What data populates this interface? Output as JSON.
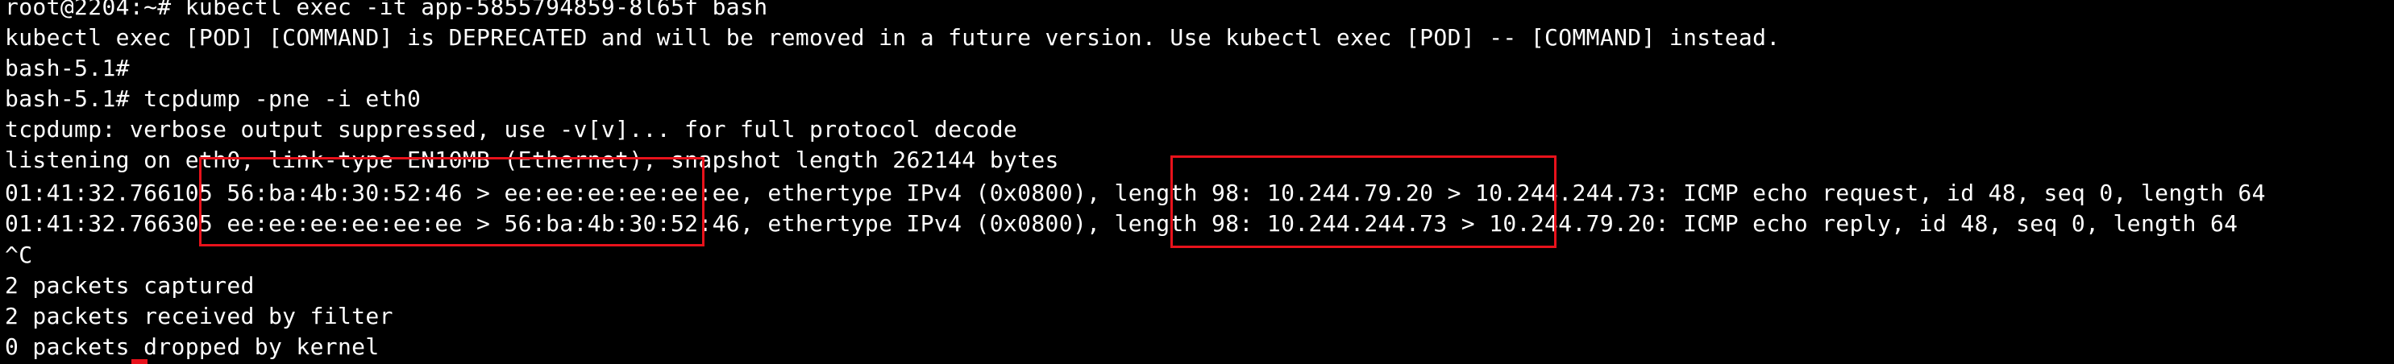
{
  "terminal": {
    "lines": [
      "root@2204:~# kubectl exec -it app-5855794859-8l65f bash",
      "kubectl exec [POD] [COMMAND] is DEPRECATED and will be removed in a future version. Use kubectl exec [POD] -- [COMMAND] instead.",
      "bash-5.1#",
      "bash-5.1# tcpdump -pne -i eth0",
      "tcpdump: verbose output suppressed, use -v[v]... for full protocol decode",
      "listening on eth0, link-type EN10MB (Ethernet), snapshot length 262144 bytes",
      "01:41:32.766105 56:ba:4b:30:52:46 > ee:ee:ee:ee:ee:ee, ethertype IPv4 (0x0800), length 98: 10.244.79.20 > 10.244.244.73: ICMP echo request, id 48, seq 0, length 64",
      "01:41:32.766305 ee:ee:ee:ee:ee:ee > 56:ba:4b:30:52:46, ethertype IPv4 (0x0800), length 98: 10.244.244.73 > 10.244.79.20: ICMP echo reply, id 48, seq 0, length 64",
      "^C",
      "2 packets captured",
      "2 packets received by filter",
      "0 packets dropped by kernel"
    ]
  },
  "colors": {
    "background": "#000000",
    "text": "#ffffff",
    "highlight_box": "#e8121b"
  }
}
